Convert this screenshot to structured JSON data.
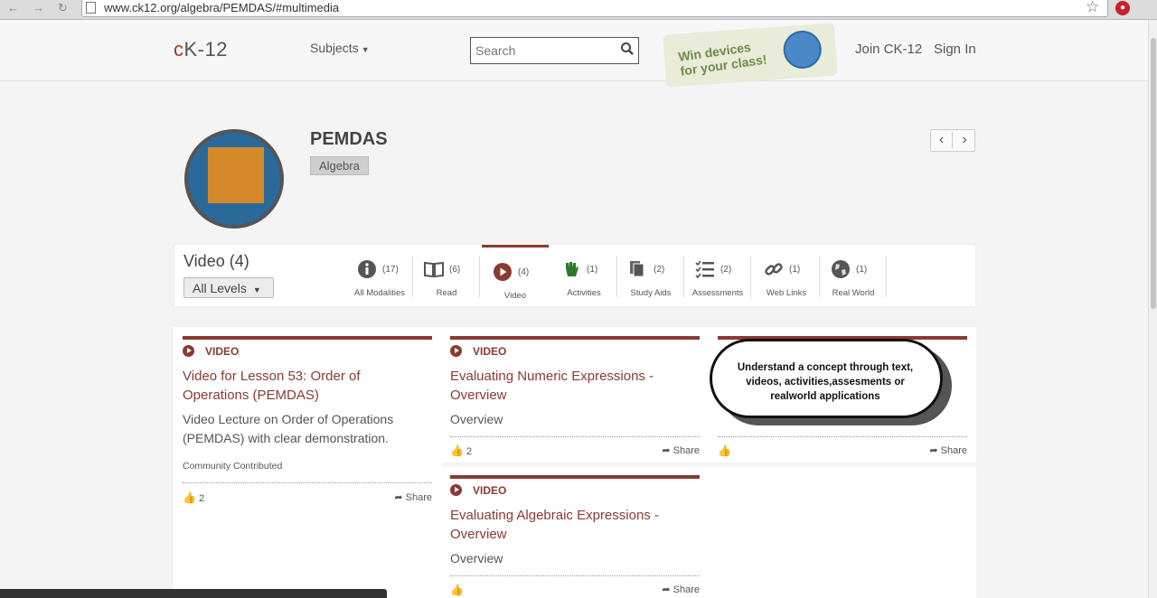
{
  "browser": {
    "url": "www.ck12.org/algebra/PEMDAS/#multimedia"
  },
  "header": {
    "logo": "cK-12",
    "subjects": "Subjects",
    "search_placeholder": "Search",
    "promo_line1": "Win devices",
    "promo_line2": "for your class!",
    "join": "Join CK-12",
    "signin": "Sign In"
  },
  "concept": {
    "title": "PEMDAS",
    "subject": "Algebra"
  },
  "modality": {
    "heading": "Video (4)",
    "level": "All Levels",
    "tabs": [
      {
        "label": "All Modalities",
        "count": "(17)",
        "icon": "info-icon"
      },
      {
        "label": "Read",
        "count": "(6)",
        "icon": "book-icon"
      },
      {
        "label": "Video",
        "count": "(4)",
        "icon": "play-icon"
      },
      {
        "label": "Activities",
        "count": "(1)",
        "icon": "hand-icon"
      },
      {
        "label": "Study Aids",
        "count": "(2)",
        "icon": "pages-icon"
      },
      {
        "label": "Assessments",
        "count": "(2)",
        "icon": "checklist-icon"
      },
      {
        "label": "Web Links",
        "count": "(1)",
        "icon": "link-icon"
      },
      {
        "label": "Real World",
        "count": "(1)",
        "icon": "globe-icon"
      }
    ]
  },
  "cards": [
    {
      "type": "VIDEO",
      "title": "Video for Lesson 53: Order of Operations (PEMDAS)",
      "desc": "Video Lecture on Order of Operations (PEMDAS) with clear demonstration.",
      "contrib": "Community Contributed",
      "likes": "2",
      "share": "Share"
    },
    {
      "type": "VIDEO",
      "title": "Evaluating Numeric Expressions - Overview",
      "desc": "Overview",
      "likes": "2",
      "share": "Share"
    },
    {
      "type": "VIDEO",
      "title": "Evaluating Algebraic Expressions - Overview",
      "desc": "Overview",
      "likes": "",
      "share": "Share"
    },
    {
      "likes": "",
      "share": "Share"
    }
  ],
  "callout": "Understand a concept through text, videos, activities,assesments or realworld applications"
}
